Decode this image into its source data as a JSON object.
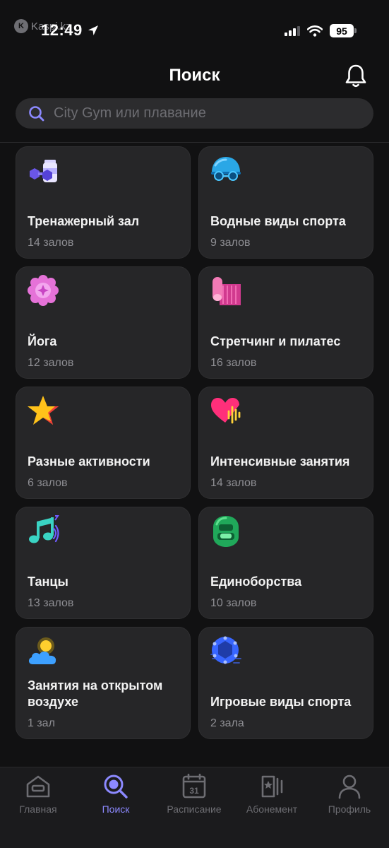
{
  "status_bar": {
    "watermark": "Kaspi.kz",
    "time": "12:49",
    "battery": "95"
  },
  "header": {
    "title": "Поиск"
  },
  "search": {
    "placeholder": "City Gym или плавание"
  },
  "categories": [
    {
      "name": "Тренажерный зал",
      "count": "14 залов",
      "icon": "dumbbell-bottle-icon"
    },
    {
      "name": "Водные виды спорта",
      "count": "9 залов",
      "icon": "swim-cap-goggles-icon"
    },
    {
      "name": "Йога",
      "count": "12 залов",
      "icon": "lotus-flower-icon"
    },
    {
      "name": "Стретчинг и пилатес",
      "count": "16 залов",
      "icon": "yoga-mat-icon"
    },
    {
      "name": "Разные активности",
      "count": "6 залов",
      "icon": "star-icon"
    },
    {
      "name": "Интенсивные занятия",
      "count": "14 залов",
      "icon": "heart-pulse-icon"
    },
    {
      "name": "Танцы",
      "count": "13 залов",
      "icon": "music-note-icon"
    },
    {
      "name": "Единоборства",
      "count": "10 залов",
      "icon": "boxing-helmet-icon"
    },
    {
      "name": "Занятия на открытом воздухе",
      "count": "1 зал",
      "icon": "sun-cloud-icon"
    },
    {
      "name": "Игровые виды спорта",
      "count": "2 зала",
      "icon": "ball-icon"
    }
  ],
  "tabbar": {
    "items": [
      {
        "label": "Главная",
        "icon": "home-icon",
        "active": false
      },
      {
        "label": "Поиск",
        "icon": "search-icon",
        "active": true
      },
      {
        "label": "Расписание",
        "icon": "calendar-icon",
        "active": false
      },
      {
        "label": "Абонемент",
        "icon": "ticket-icon",
        "active": false
      },
      {
        "label": "Профиль",
        "icon": "profile-icon",
        "active": false
      }
    ],
    "calendar_day": "31"
  },
  "colors": {
    "background": "#111112",
    "card": "#262628",
    "accent": "#8c89ff",
    "muted_text": "#8e8e93"
  }
}
